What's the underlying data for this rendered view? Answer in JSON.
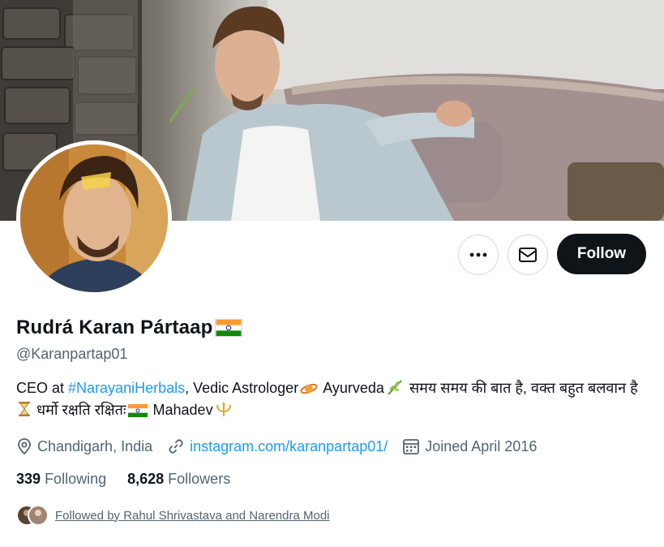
{
  "profile": {
    "display_name": "Rudrá Karan Pártaap",
    "handle": "@Karanpartap01",
    "bio": {
      "prefix": "CEO at ",
      "hashtag": "#NarayaniHerbals",
      "text1": ", Vedic Astrologer",
      "text2": " Ayurveda",
      "text3": " समय समय की बात है, वक्त बहुत बलवान है",
      "text4": " धर्मो रक्षति रक्षितः",
      "text5": " Mahadev"
    },
    "location": "Chandigarh, India",
    "website": "instagram.com/karanpartap01/",
    "joined": "Joined April 2016",
    "following_count": "339",
    "following_label": "Following",
    "followers_count": "8,628",
    "followers_label": "Followers",
    "followed_by": "Followed by Rahul Shrivastava and Narendra Modi"
  },
  "actions": {
    "more_icon": "more-icon",
    "message_icon": "envelope-icon",
    "follow_label": "Follow"
  },
  "colors": {
    "link": "#1d9bf0",
    "secondary_text": "#536471",
    "primary_text": "#0f1419",
    "follow_button_bg": "#0f1419"
  }
}
